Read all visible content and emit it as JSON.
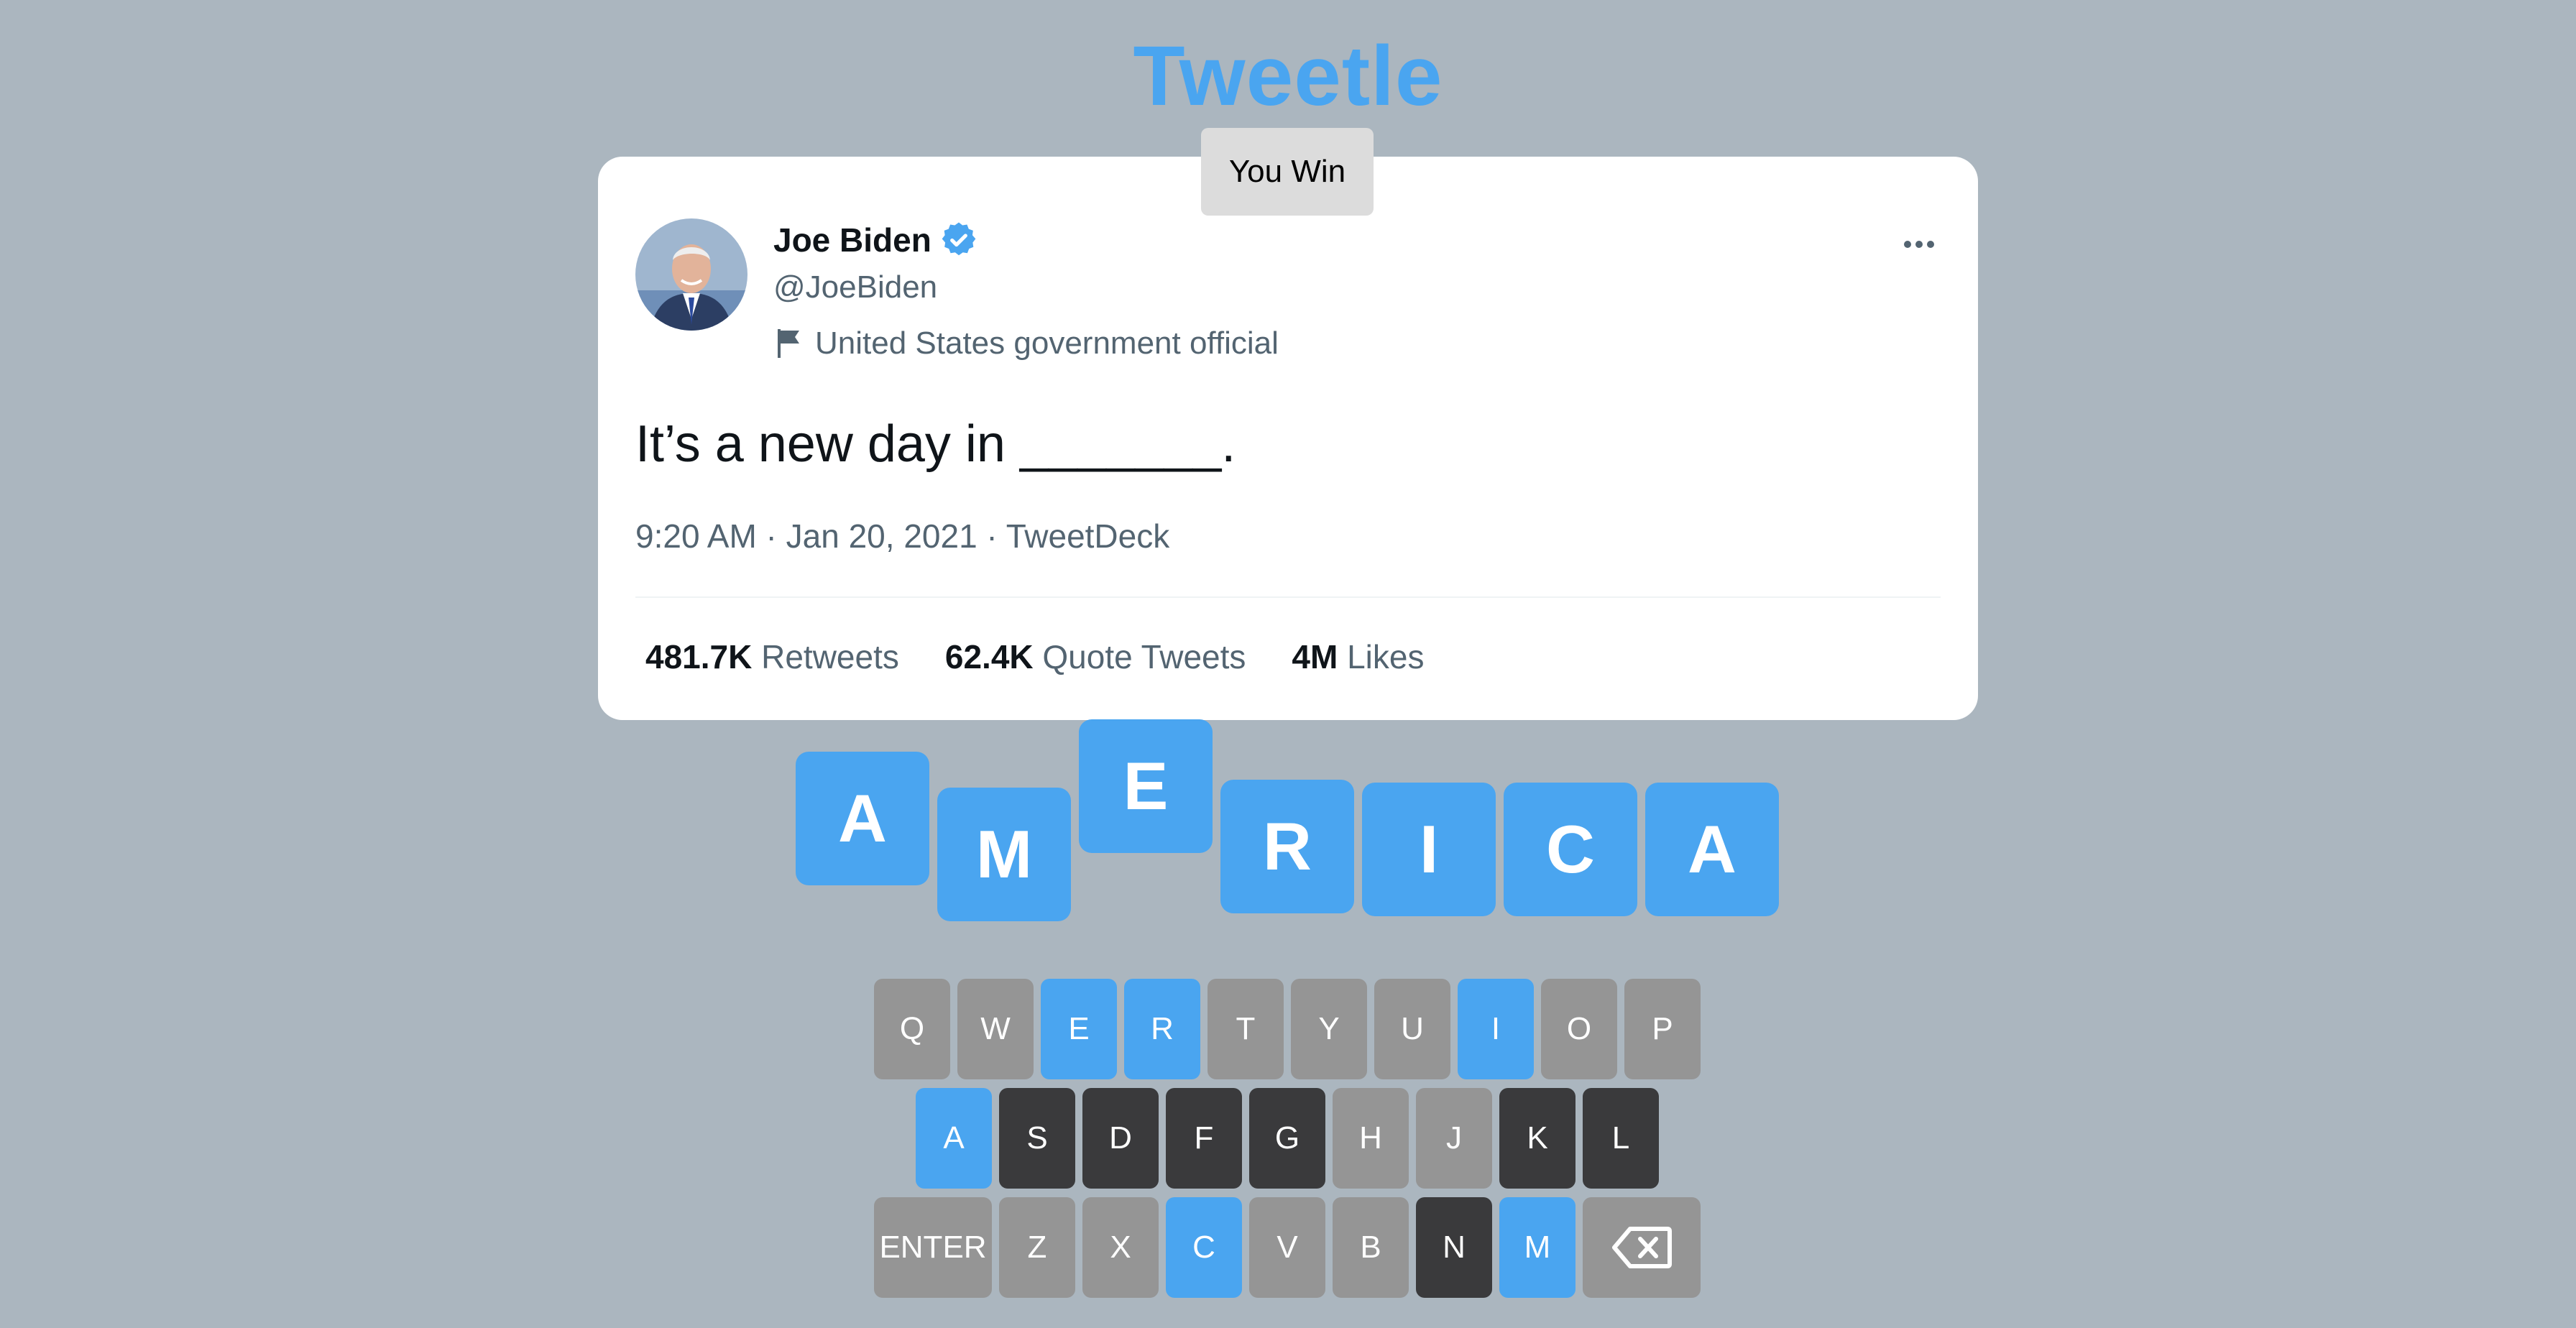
{
  "app": {
    "title": "Tweetle"
  },
  "toast": {
    "text": "You Win"
  },
  "tweet": {
    "author_name": "Joe Biden",
    "handle": "@JoeBiden",
    "label": "United States government official",
    "text": "It’s a new day in _______.",
    "meta": "9:20 AM · Jan 20, 2021 · TweetDeck",
    "stats": [
      {
        "value": "481.7K",
        "label": "Retweets"
      },
      {
        "value": "62.4K",
        "label": "Quote Tweets"
      },
      {
        "value": "4M",
        "label": "Likes"
      }
    ]
  },
  "answer_tiles": [
    "A",
    "M",
    "E",
    "R",
    "I",
    "C",
    "A"
  ],
  "keyboard": {
    "row1": [
      "Q",
      "W",
      "E",
      "R",
      "T",
      "Y",
      "U",
      "I",
      "O",
      "P"
    ],
    "row2": [
      "A",
      "S",
      "D",
      "F",
      "G",
      "H",
      "J",
      "K",
      "L"
    ],
    "row3": [
      "ENTER",
      "Z",
      "X",
      "C",
      "V",
      "B",
      "N",
      "M"
    ],
    "backspace_icon": "backspace-icon"
  },
  "colors": {
    "background": "#abb6bf",
    "accent": "#4aa5f0",
    "key_absent": "#3a3a3c",
    "key_unused": "#959595",
    "key_correct": "#4aa5f0"
  }
}
